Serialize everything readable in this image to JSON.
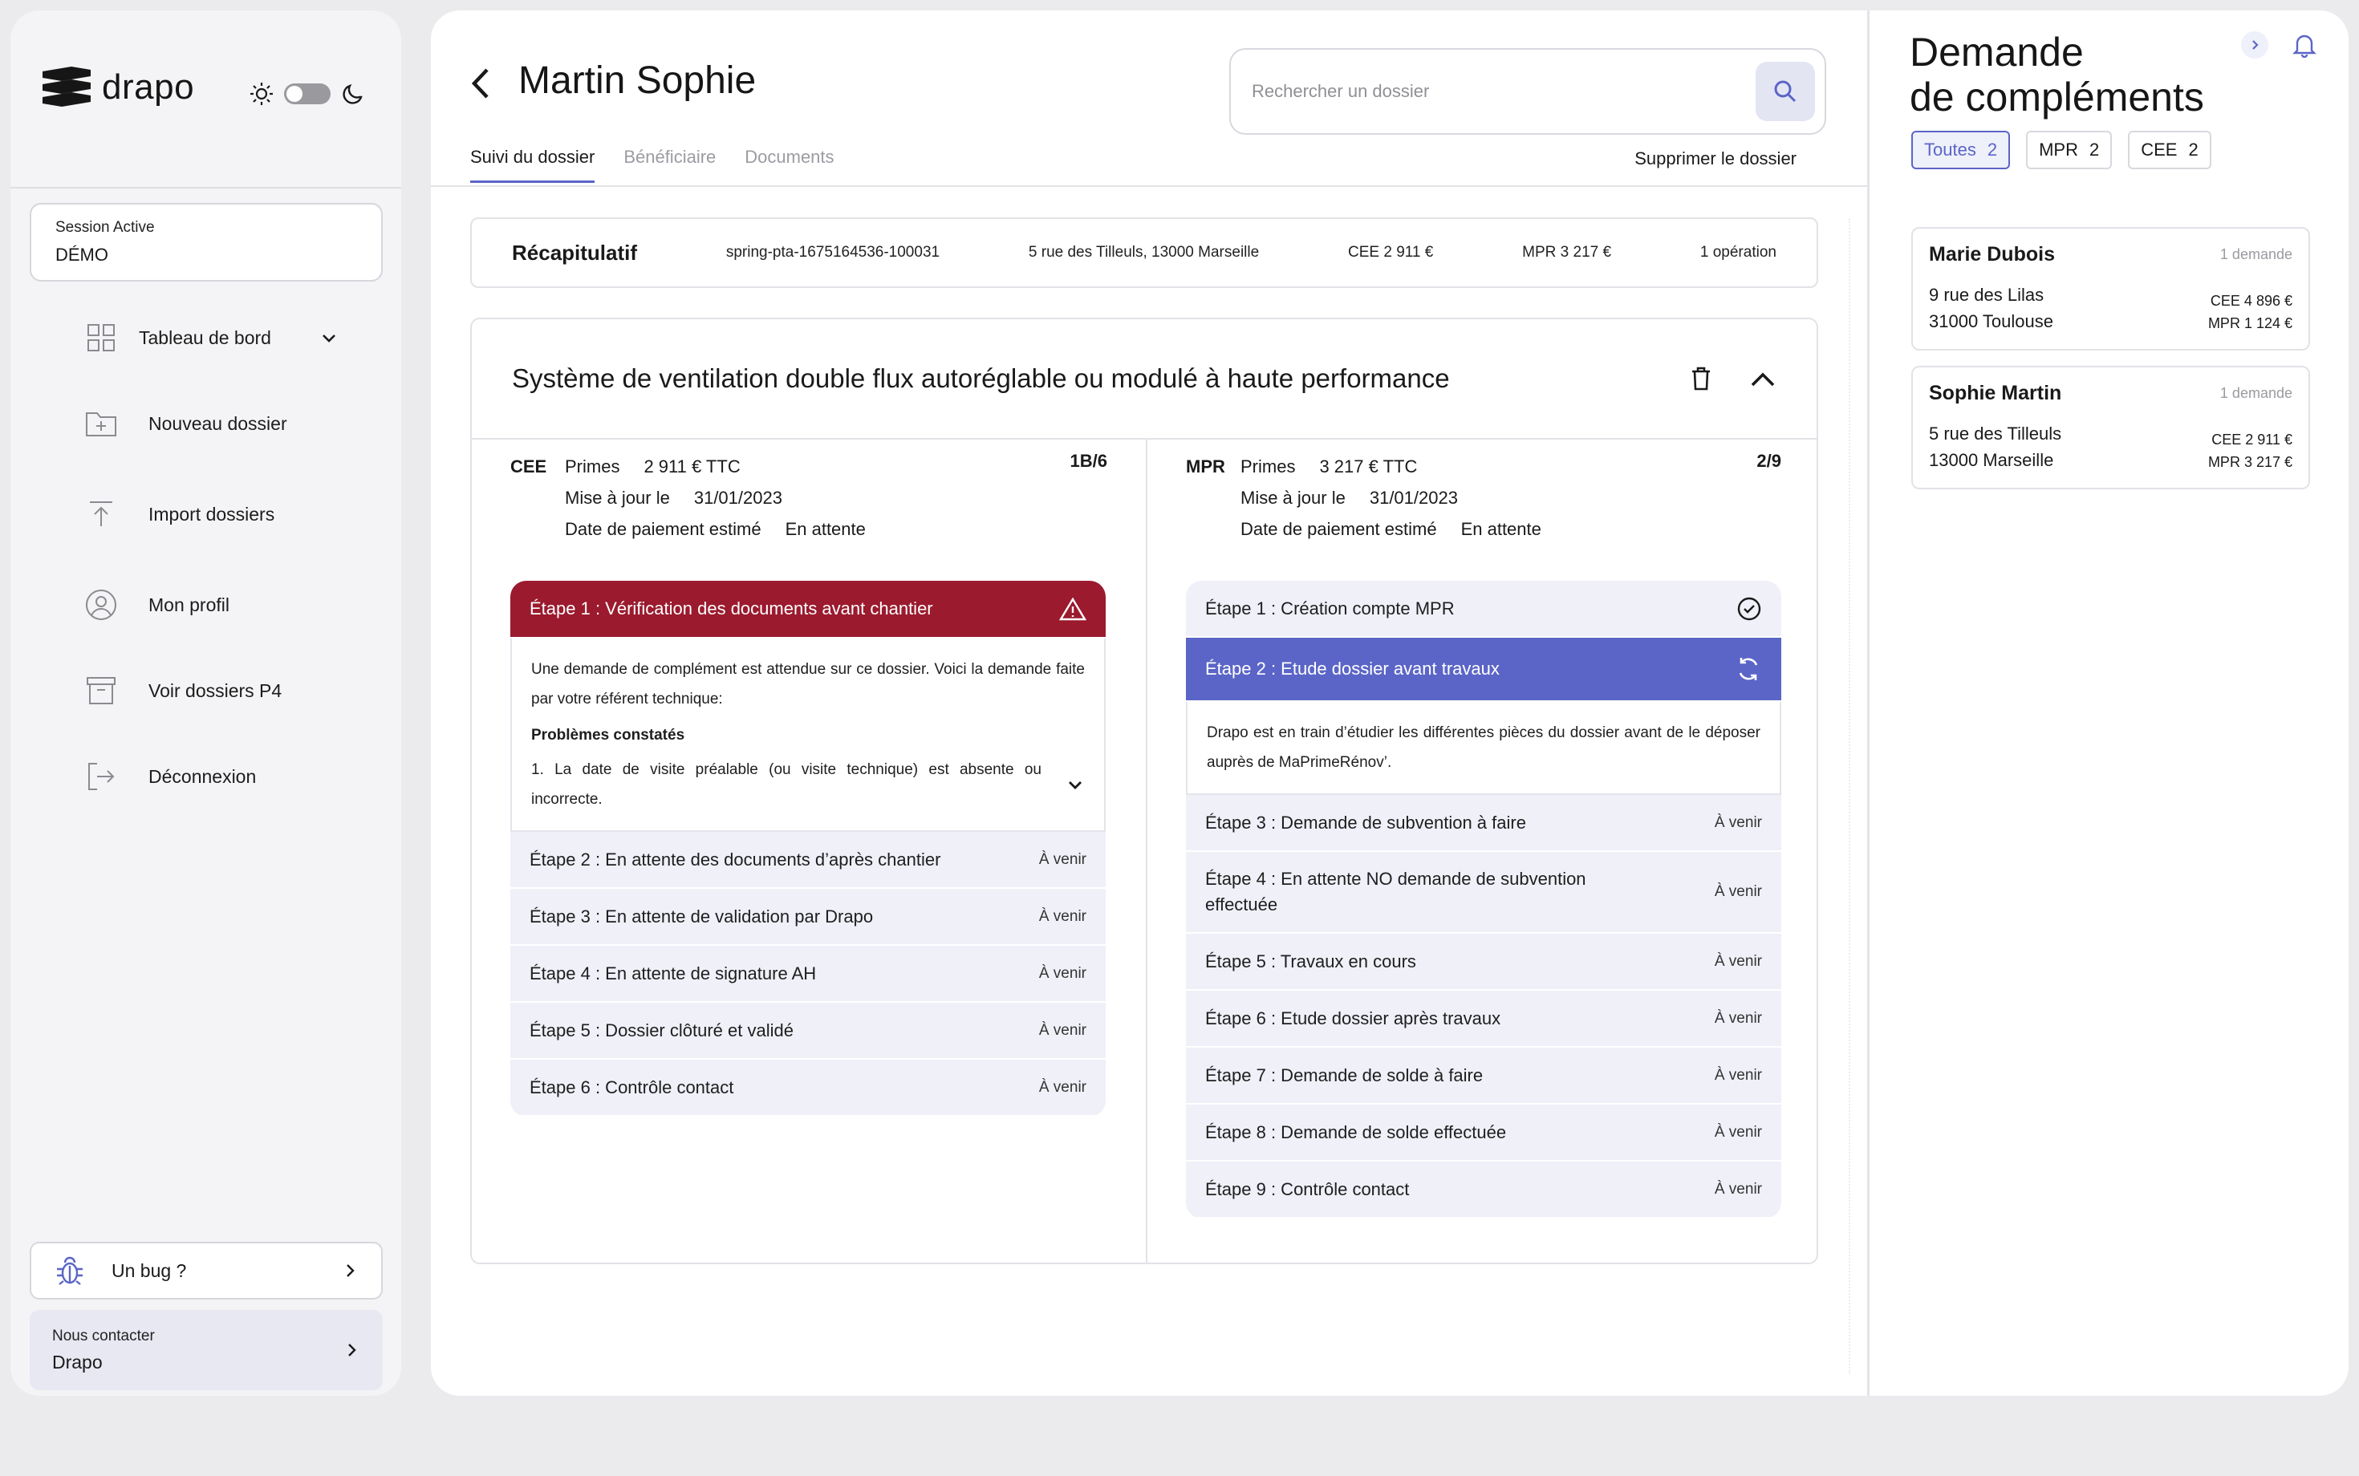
{
  "brand": {
    "name": "drapo"
  },
  "session": {
    "label": "Session Active",
    "value": "DÉMO"
  },
  "nav": [
    {
      "label": "Tableau de bord"
    },
    {
      "label": "Nouveau dossier"
    },
    {
      "label": "Import dossiers"
    },
    {
      "label": "Mon profil"
    },
    {
      "label": "Voir dossiers P4"
    },
    {
      "label": "Déconnexion"
    }
  ],
  "bug": {
    "label": "Un bug ?"
  },
  "contact": {
    "label": "Nous contacter",
    "value": "Drapo"
  },
  "header": {
    "title": "Martin Sophie",
    "search_placeholder": "Rechercher un dossier",
    "tabs": [
      "Suivi du dossier",
      "Bénéficiaire",
      "Documents"
    ],
    "delete_label": "Supprimer le dossier"
  },
  "recap": {
    "title": "Récapitulatif",
    "ref": "spring-pta-1675164536-100031",
    "address": "5 rue des Tilleuls, 13000 Marseille",
    "cee": "CEE 2 911 €",
    "mpr": "MPR 3 217 €",
    "ops": "1 opération"
  },
  "operation": {
    "title": "Système de ventilation double flux autoréglable ou modulé à haute performance",
    "cee": {
      "tag": "CEE",
      "primes_label": "Primes",
      "primes": "2 911 € TTC",
      "update_label": "Mise à jour le",
      "update": "31/01/2023",
      "pay_label": "Date de paiement estimé",
      "pay": "En attente",
      "count": "1B/6",
      "alert_step": "Étape 1 : Vérification des documents avant chantier",
      "alert_text": "Une demande de complément est attendue sur ce dossier. Voici la demande faite par votre référent technique:",
      "problems_title": "Problèmes constatés",
      "problem_1": "1. La date de visite préalable (ou visite technique) est absente ou incorrecte.",
      "steps": [
        {
          "label": "Étape 2 : En attente des documents d’après chantier",
          "status": "À venir"
        },
        {
          "label": "Étape 3 : En attente de validation par Drapo",
          "status": "À venir"
        },
        {
          "label": "Étape 4 : En attente de signature AH",
          "status": "À venir"
        },
        {
          "label": "Étape 5 : Dossier clôturé et validé",
          "status": "À venir"
        },
        {
          "label": "Étape 6 : Contrôle contact",
          "status": "À venir"
        }
      ]
    },
    "mpr": {
      "tag": "MPR",
      "primes_label": "Primes",
      "primes": "3 217 € TTC",
      "update_label": "Mise à jour le",
      "update": "31/01/2023",
      "pay_label": "Date de paiement estimé",
      "pay": "En attente",
      "count": "2/9",
      "done_step": "Étape 1 : Création compte MPR",
      "active_step": "Étape 2 : Etude dossier avant travaux",
      "active_text": "Drapo est en train d’étudier les différentes pièces du dossier avant de le déposer auprès de MaPrimeRénov’.",
      "steps": [
        {
          "label": "Étape 3 : Demande de subvention à faire",
          "status": "À venir"
        },
        {
          "label": "Étape 4 : En attente NO demande de subvention effectuée",
          "status": "À venir"
        },
        {
          "label": "Étape 5 : Travaux en cours",
          "status": "À venir"
        },
        {
          "label": "Étape 6 : Etude dossier après travaux",
          "status": "À venir"
        },
        {
          "label": "Étape 7 : Demande de solde à faire",
          "status": "À venir"
        },
        {
          "label": "Étape 8 : Demande de solde effectuée",
          "status": "À venir"
        },
        {
          "label": "Étape 9 : Contrôle contact",
          "status": "À venir"
        }
      ]
    }
  },
  "panel": {
    "title_line1": "Demande",
    "title_line2": "de compléments",
    "filters": [
      {
        "label": "Toutes",
        "count": "2"
      },
      {
        "label": "MPR",
        "count": "2"
      },
      {
        "label": "CEE",
        "count": "2"
      }
    ],
    "requests": [
      {
        "name": "Marie Dubois",
        "count": "1 demande",
        "addr1": "9 rue des Lilas",
        "addr2": "31000 Toulouse",
        "cee": "CEE 4 896 €",
        "mpr": "MPR 1 124 €"
      },
      {
        "name": "Sophie Martin",
        "count": "1 demande",
        "addr1": "5 rue des Tilleuls",
        "addr2": "13000 Marseille",
        "cee": "CEE 2 911 €",
        "mpr": "MPR 3 217 €"
      }
    ]
  },
  "colors": {
    "accent": "#5b65c7",
    "alert": "#9b1a2e",
    "step_bg": "#eff0f8"
  }
}
